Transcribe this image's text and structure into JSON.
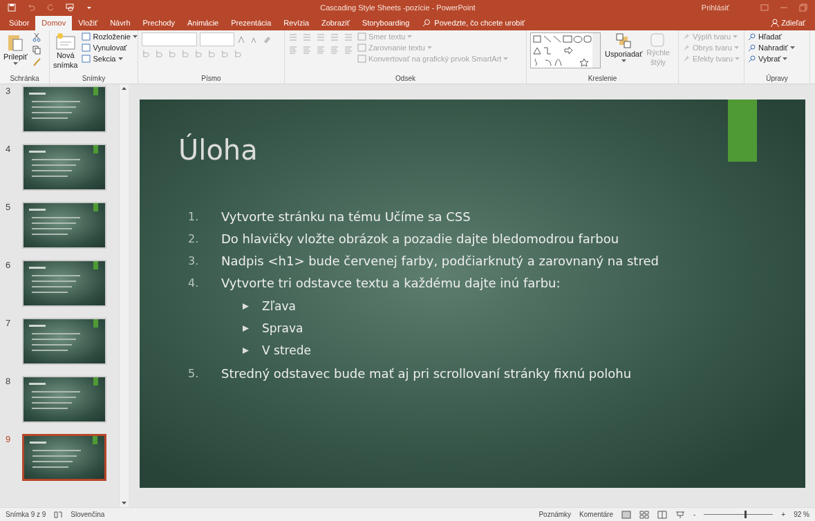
{
  "window": {
    "title": "Cascading Style Sheets -pozície  -  PowerPoint",
    "sign_in": "Prihlásiť"
  },
  "tabs": [
    {
      "label": "Súbor",
      "selected": false
    },
    {
      "label": "Domov",
      "selected": true
    },
    {
      "label": "Vložiť",
      "selected": false
    },
    {
      "label": "Návrh",
      "selected": false
    },
    {
      "label": "Prechody",
      "selected": false
    },
    {
      "label": "Animácie",
      "selected": false
    },
    {
      "label": "Prezentácia",
      "selected": false
    },
    {
      "label": "Revízia",
      "selected": false
    },
    {
      "label": "Zobraziť",
      "selected": false
    },
    {
      "label": "Storyboarding",
      "selected": false
    }
  ],
  "tell_me": {
    "placeholder": "Povedzte, čo chcete urobiť"
  },
  "share": "Zdieľať",
  "ribbon": {
    "clipboard": {
      "title": "Schránka",
      "paste": "Prilepiť"
    },
    "slides": {
      "title": "Snímky",
      "new_slide": [
        "Nová",
        "snímka"
      ],
      "items": [
        {
          "label": "Rozloženie",
          "disabled": false
        },
        {
          "label": "Vynulovať",
          "disabled": false
        },
        {
          "label": "Sekcia",
          "disabled": false
        }
      ]
    },
    "font": {
      "title": "Písmo"
    },
    "paragraph": {
      "title": "Odsek",
      "items": [
        {
          "label": "Smer textu",
          "disabled": true
        },
        {
          "label": "Zarovnanie textu",
          "disabled": true
        },
        {
          "label": "Konvertovať na grafický prvok SmartArt",
          "disabled": true
        }
      ]
    },
    "drawing": {
      "title": "Kreslenie",
      "arrange": "Usporiadať",
      "quick_styles": {
        "label": [
          "Rýchle",
          "štýly"
        ],
        "disabled": true
      },
      "items": [
        {
          "label": "Výplň tvaru",
          "disabled": true
        },
        {
          "label": "Obrys tvaru",
          "disabled": true
        },
        {
          "label": "Efekty tvaru",
          "disabled": true
        }
      ]
    },
    "editing": {
      "title": "Úpravy",
      "items": [
        {
          "label": "Hľadať",
          "disabled": false
        },
        {
          "label": "Nahradiť",
          "disabled": false
        },
        {
          "label": "Vybrať",
          "disabled": false
        }
      ]
    }
  },
  "thumbnails": [
    {
      "number": "3",
      "selected": false
    },
    {
      "number": "4",
      "selected": false
    },
    {
      "number": "5",
      "selected": false
    },
    {
      "number": "6",
      "selected": false
    },
    {
      "number": "7",
      "selected": false
    },
    {
      "number": "8",
      "selected": false
    },
    {
      "number": "9",
      "selected": true
    }
  ],
  "slide": {
    "title": "Úloha",
    "items": [
      {
        "number": "1.",
        "text": "Vytvorte stránku na tému Učíme sa CSS"
      },
      {
        "number": "2.",
        "text": "Do hlavičky vložte obrázok a pozadie dajte bledomodrou farbou"
      },
      {
        "number": "3.",
        "text": "Nadpis <h1> bude červenej farby, podčiarknutý a zarovnaný na stred"
      },
      {
        "number": "4.",
        "text": "Vytvorte tri odstavce textu a každému dajte inú farbu:",
        "children": [
          {
            "text": "Zľava"
          },
          {
            "text": "Sprava"
          },
          {
            "text": "V strede"
          }
        ]
      },
      {
        "number": "5.",
        "text": "Stredný odstavec bude mať aj pri scrollovaní stránky fixnú polohu"
      }
    ]
  },
  "status_bar": {
    "slide_count": "Snímka 9 z 9",
    "language": "Slovenčina",
    "notes": "Poznámky",
    "comments": "Komentáre",
    "zoom_minus": "-",
    "zoom_plus": "+",
    "zoom": {
      "level": 0.59
    },
    "zoom_value": "92 %"
  }
}
